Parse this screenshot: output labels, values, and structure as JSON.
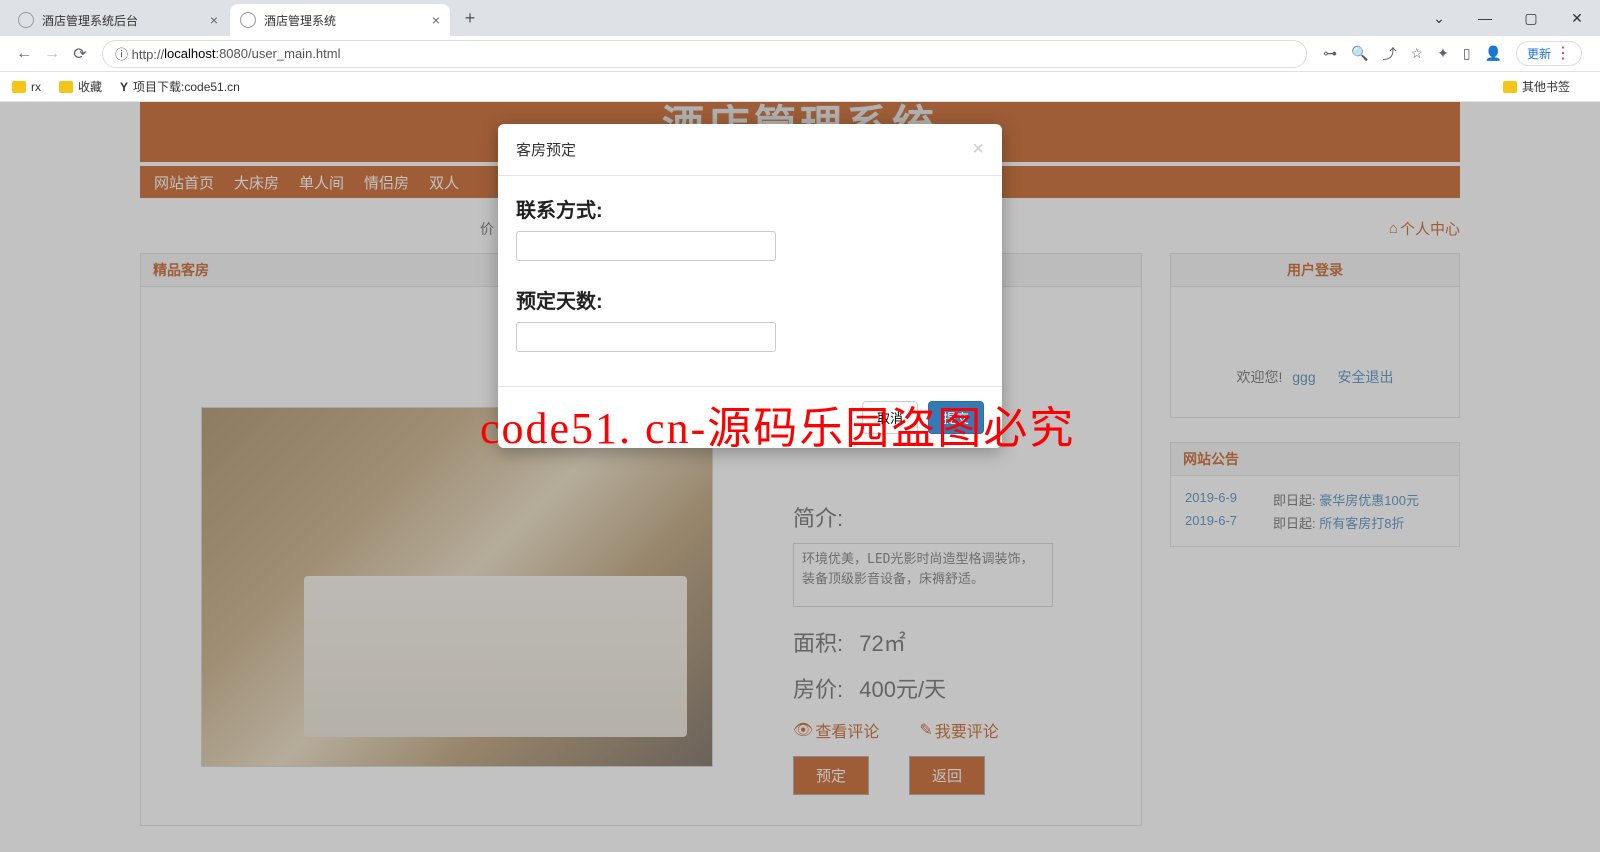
{
  "browser": {
    "tabs": [
      {
        "title": "酒店管理系统后台"
      },
      {
        "title": "酒店管理系统"
      }
    ],
    "url_prefix": "ⓘ http://",
    "url_host": "localhost",
    "url_rest": ":8080/user_main.html",
    "update_label": "更新",
    "window": {
      "min": "—",
      "max": "▢",
      "close": "✕",
      "dropdown": "⌄"
    },
    "bookmarks": {
      "rx": "rx",
      "fav": "收藏",
      "proj": "项目下载:code51.cn",
      "other": "其他书签"
    }
  },
  "page": {
    "hero_title": "酒店管理系统",
    "nav": [
      "网站首页",
      "大床房",
      "单人间",
      "情侣房",
      "双人"
    ],
    "price_prefix": "价",
    "personal_center": "个人中心",
    "panel_title": "精品客房",
    "detail": {
      "intro_label": "简介:",
      "intro_text": "环境优美，LED光影时尚造型格调装饰，装备顶级影音设备，床褥舒适。",
      "area_label": "面积:",
      "area_value": "72㎡",
      "price_label": "房价:",
      "price_value": "400元/天",
      "view_comments": "查看评论",
      "write_comment": "我要评论",
      "book_btn": "预定",
      "back_btn": "返回"
    },
    "login": {
      "title": "用户登录",
      "welcome": "欢迎您!",
      "user": "ggg",
      "logout": "安全退出"
    },
    "ann": {
      "title": "网站公告",
      "rows": [
        {
          "date": "2019-6-9",
          "pre": "即日起:",
          "text": "豪华房优惠100元"
        },
        {
          "date": "2019-6-7",
          "pre": "即日起:",
          "text": "所有客房打8折"
        }
      ]
    }
  },
  "modal": {
    "title": "客房预定",
    "contact_label": "联系方式:",
    "days_label": "预定天数:",
    "cancel": "取消",
    "submit": "提交"
  },
  "watermark": "code51. cn-源码乐园盗图必究"
}
